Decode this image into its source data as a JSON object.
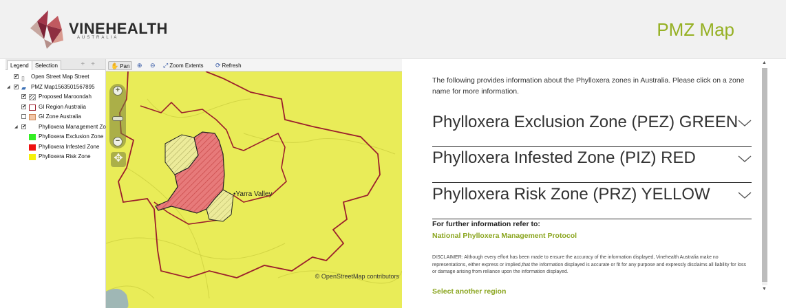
{
  "header": {
    "logo_text": "VINEHEALTH",
    "logo_sub": "AUSTRALIA",
    "page_title": "PMZ Map"
  },
  "legend_panel": {
    "tabs": [
      "Legend",
      "Selection"
    ],
    "tools": [
      "+",
      "+"
    ],
    "layers": [
      {
        "label": "Open Street Map Street",
        "checked": true
      },
      {
        "label": "PMZ Map1563501567895",
        "checked": true
      },
      {
        "label": "Proposed Maroondah",
        "checked": true
      },
      {
        "label": "GI Region Australia",
        "checked": true
      },
      {
        "label": "GI Zone Australia",
        "checked": false
      },
      {
        "label": "Phylloxera Management Zo",
        "checked": true
      },
      {
        "label": "Phylloxera Exclusion Zone",
        "swatch": "#33ee22"
      },
      {
        "label": "Phylloxera Infested Zone",
        "swatch": "#ee1111"
      },
      {
        "label": "Phylloxera Risk Zone",
        "swatch": "#f4f10c"
      }
    ]
  },
  "map_toolbar": {
    "pan": "Pan",
    "zoom_extents": "Zoom Extents",
    "refresh": "Refresh"
  },
  "map": {
    "place_label": "•Yarra Valley",
    "attribution": "© OpenStreetMap contributors",
    "colors": {
      "risk_zone": "#e9ec58",
      "infested_zone": "#e77a7a",
      "boundary": "#9b1f2c"
    }
  },
  "info": {
    "intro": "The following provides information about the Phylloxera zones in Australia. Please click on a zone name for more information.",
    "zones": [
      "Phylloxera Exclusion Zone (PEZ) GREEN",
      "Phylloxera Infested Zone (PIZ) RED",
      "Phylloxera Risk Zone (PRZ) YELLOW"
    ],
    "further_label": "For further information refer to:",
    "protocol_link": "National Phylloxera Management Protocol",
    "disclaimer": "DISCLAIMER: Although every effort has been made to ensure the accuracy of the information displayed, Vinehealth Australia make no representations, either express or implied,that the information displayed is accurate or fit for any purpose and expressly disclaims all liability for loss or damage arising from reliance upon the information displayed.",
    "select_region_link": "Select another region"
  },
  "colors": {
    "accent": "#95b022"
  }
}
